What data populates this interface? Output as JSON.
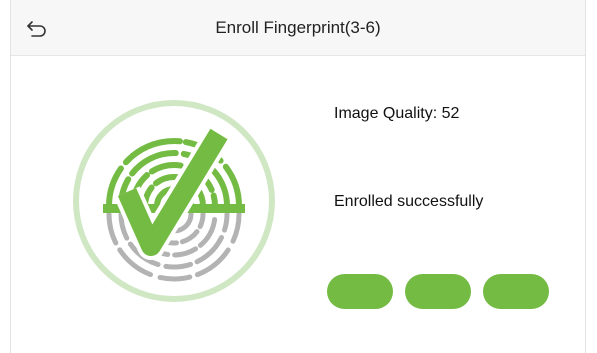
{
  "header": {
    "title": "Enroll Fingerprint(3-6)",
    "back_icon": "back-arrow-icon"
  },
  "main": {
    "image_quality_label": "Image Quality: 52",
    "status_text": "Enrolled successfully",
    "fingerprint_icon": "fingerprint-check-icon",
    "progress": {
      "completed": 3,
      "total": 3
    }
  },
  "colors": {
    "accent_green": "#74bb43",
    "ring_green": "#cfe7c3",
    "print_gray": "#b3b3b3"
  }
}
